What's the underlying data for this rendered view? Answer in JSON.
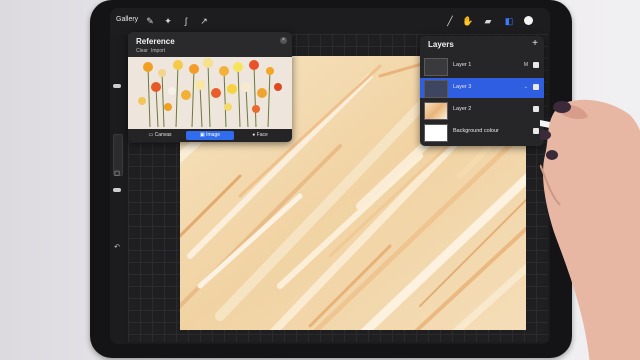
{
  "topbar": {
    "gallery_label": "Gallery",
    "left_tools": [
      "wrench-icon",
      "magic-wand-icon",
      "selection-icon",
      "transform-arrow-icon"
    ],
    "right_tools": [
      "brush-icon",
      "smudge-icon",
      "eraser-icon",
      "layers-icon",
      "color-swatch"
    ]
  },
  "reference": {
    "title": "Reference",
    "clear_label": "Clear",
    "import_label": "Import",
    "tabs": [
      {
        "label": "Canvas",
        "active": false
      },
      {
        "label": "Image",
        "active": true
      },
      {
        "label": "Face",
        "active": false
      }
    ]
  },
  "layers": {
    "title": "Layers",
    "add_label": "+",
    "items": [
      {
        "name": "Layer 1",
        "mode": "M",
        "visible": true,
        "selected": false
      },
      {
        "name": "Layer 3",
        "mode": "",
        "visible": true,
        "selected": true
      },
      {
        "name": "Layer 2",
        "mode": "",
        "visible": true,
        "selected": false
      },
      {
        "name": "Background colour",
        "mode": "",
        "visible": true,
        "selected": false
      }
    ]
  },
  "colors": {
    "accent_blue": "#2f6cf0",
    "canvas_base": "#f2d8ad",
    "panel_bg": "#262629"
  }
}
